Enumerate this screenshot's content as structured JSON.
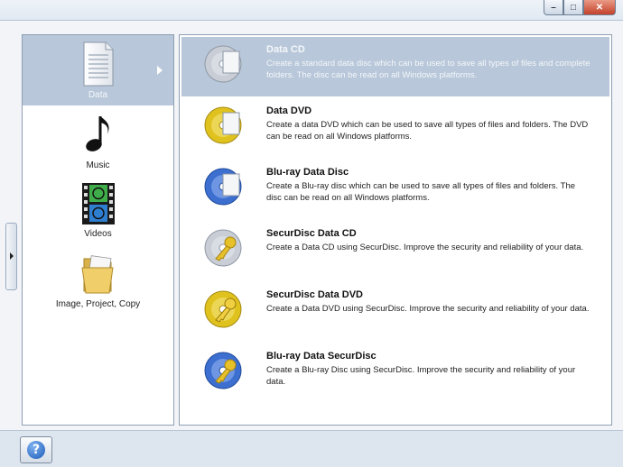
{
  "window": {
    "min_glyph": "–",
    "max_glyph": "□",
    "close_glyph": "✕"
  },
  "categories": [
    {
      "label": "Data",
      "icon": "document-icon",
      "selected": true
    },
    {
      "label": "Music",
      "icon": "music-note-icon",
      "selected": false
    },
    {
      "label": "Videos",
      "icon": "film-icon",
      "selected": false
    },
    {
      "label": "Image, Project, Copy",
      "icon": "folder-icon",
      "selected": false
    }
  ],
  "tasks": [
    {
      "title": "Data CD",
      "desc": "Create a standard data disc which can be used to save all types of files and complete folders. The disc can be read on all Windows platforms.",
      "icon": "data-cd-icon",
      "selected": true
    },
    {
      "title": "Data DVD",
      "desc": "Create a data DVD which can be used to save all types of files and folders. The DVD can be read on all Windows platforms.",
      "icon": "data-dvd-icon",
      "selected": false
    },
    {
      "title": "Blu-ray Data Disc",
      "desc": "Create a Blu-ray disc which can be used to save all types of files and folders. The disc can be read on all Windows platforms.",
      "icon": "bluray-disc-icon",
      "selected": false
    },
    {
      "title": "SecurDisc Data CD",
      "desc": "Create a Data CD using SecurDisc. Improve the security and reliability of your data.",
      "icon": "securdisc-cd-icon",
      "selected": false
    },
    {
      "title": "SecurDisc Data DVD",
      "desc": "Create a Data DVD using SecurDisc. Improve the security and reliability of your data.",
      "icon": "securdisc-dvd-icon",
      "selected": false
    },
    {
      "title": "Blu-ray Data SecurDisc",
      "desc": "Create a Blu-ray Disc using SecurDisc. Improve the security and reliability of your data.",
      "icon": "bluray-securdisc-icon",
      "selected": false
    }
  ],
  "help": {
    "glyph": "?"
  },
  "colors": {
    "selection": "#b8c7d9",
    "cd_silver": "#c9ced6",
    "dvd_gold": "#e0c21f",
    "bluray_blue": "#3d6fd0"
  }
}
